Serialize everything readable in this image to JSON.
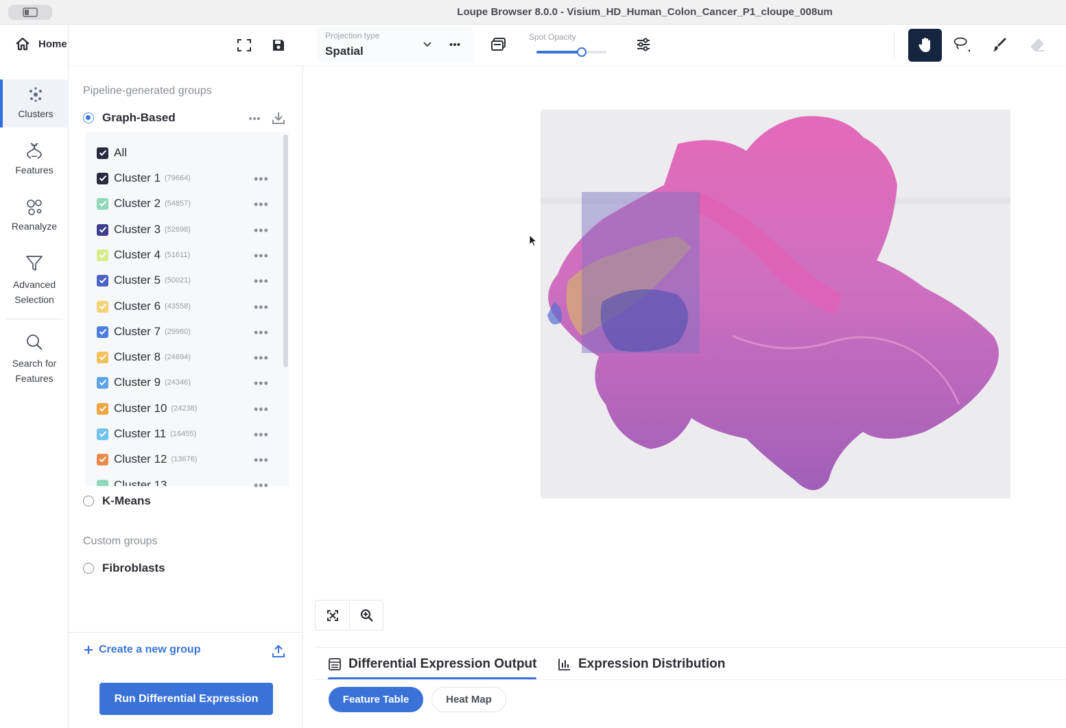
{
  "window": {
    "title": "Loupe Browser 8.0.0 - Visium_HD_Human_Colon_Cancer_P1_cloupe_008um"
  },
  "header": {
    "home_label": "Home"
  },
  "rail": {
    "items": [
      {
        "label": "Clusters",
        "icon": "clusters-icon"
      },
      {
        "label": "Features",
        "icon": "dna-icon"
      },
      {
        "label": "Reanalyze",
        "icon": "reanalyze-icon"
      },
      {
        "label": "Advanced Selection",
        "label_line1": "Advanced",
        "label_line2": "Selection",
        "icon": "filter-icon"
      },
      {
        "label": "Search for Features",
        "label_line1": "Search for",
        "label_line2": "Features",
        "icon": "search-icon"
      }
    ]
  },
  "toolbar": {
    "projection_label": "Projection type",
    "projection_value": "Spatial",
    "opacity_label": "Spot Opacity",
    "opacity_fraction": 0.65
  },
  "panel": {
    "pipeline_title": "Pipeline-generated groups",
    "graph_based": "Graph-Based",
    "all_label": "All",
    "clusters": [
      {
        "name": "Cluster 1",
        "count": "(79664)",
        "color": "#2a2940"
      },
      {
        "name": "Cluster 2",
        "count": "(54857)",
        "color": "#8fd9b8"
      },
      {
        "name": "Cluster 3",
        "count": "(52698)",
        "color": "#3d3f8c"
      },
      {
        "name": "Cluster 4",
        "count": "(51611)",
        "color": "#d7ec8a"
      },
      {
        "name": "Cluster 5",
        "count": "(50021)",
        "color": "#4a63c4"
      },
      {
        "name": "Cluster 6",
        "count": "(43558)",
        "color": "#f3d27a"
      },
      {
        "name": "Cluster 7",
        "count": "(29980)",
        "color": "#4b7ee0"
      },
      {
        "name": "Cluster 8",
        "count": "(24694)",
        "color": "#f2c25f"
      },
      {
        "name": "Cluster 9",
        "count": "(24346)",
        "color": "#5aa3e8"
      },
      {
        "name": "Cluster 10",
        "count": "(24238)",
        "color": "#eea441"
      },
      {
        "name": "Cluster 11",
        "count": "(16455)",
        "color": "#6fc2ea"
      },
      {
        "name": "Cluster 12",
        "count": "(13676)",
        "color": "#e88a49"
      }
    ],
    "kmeans": "K-Means",
    "custom_title": "Custom groups",
    "fibroblasts": "Fibroblasts",
    "create_group": "Create a new group",
    "run_button": "Run Differential Expression"
  },
  "bottom": {
    "tab_diff": "Differential Expression Output",
    "tab_dist": "Expression Distribution",
    "pill_feature": "Feature Table",
    "pill_heatmap": "Heat Map"
  }
}
